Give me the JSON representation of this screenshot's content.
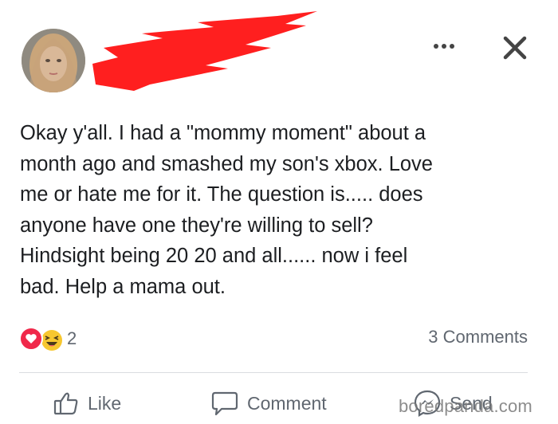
{
  "post": {
    "text": "Okay y'all. I had a \"mommy moment\" about a\nmonth ago and smashed my son's xbox. Love\nme or hate me for it. The question is..... does\nanyone have one they're willing to sell?\nHindsight being 20 20 and all...... now i feel\nbad. Help a mama out.",
    "reaction_count": "2",
    "comments_label": "3 Comments"
  },
  "actions": {
    "like_label": "Like",
    "comment_label": "Comment",
    "send_label": "Send"
  },
  "icons": {
    "avatar": "profile-photo",
    "more": "more-options-icon",
    "close": "close-icon",
    "love_reaction": "heart-icon",
    "haha_reaction": "laughing-face-icon",
    "like": "thumbs-up-icon",
    "comment": "speech-bubble-icon",
    "send": "messenger-icon"
  },
  "colors": {
    "redaction": "#ff1f1f",
    "love": "#f0284a",
    "haha": "#f7c72f",
    "muted_text": "#606770"
  },
  "watermark": "boredpanda.com"
}
